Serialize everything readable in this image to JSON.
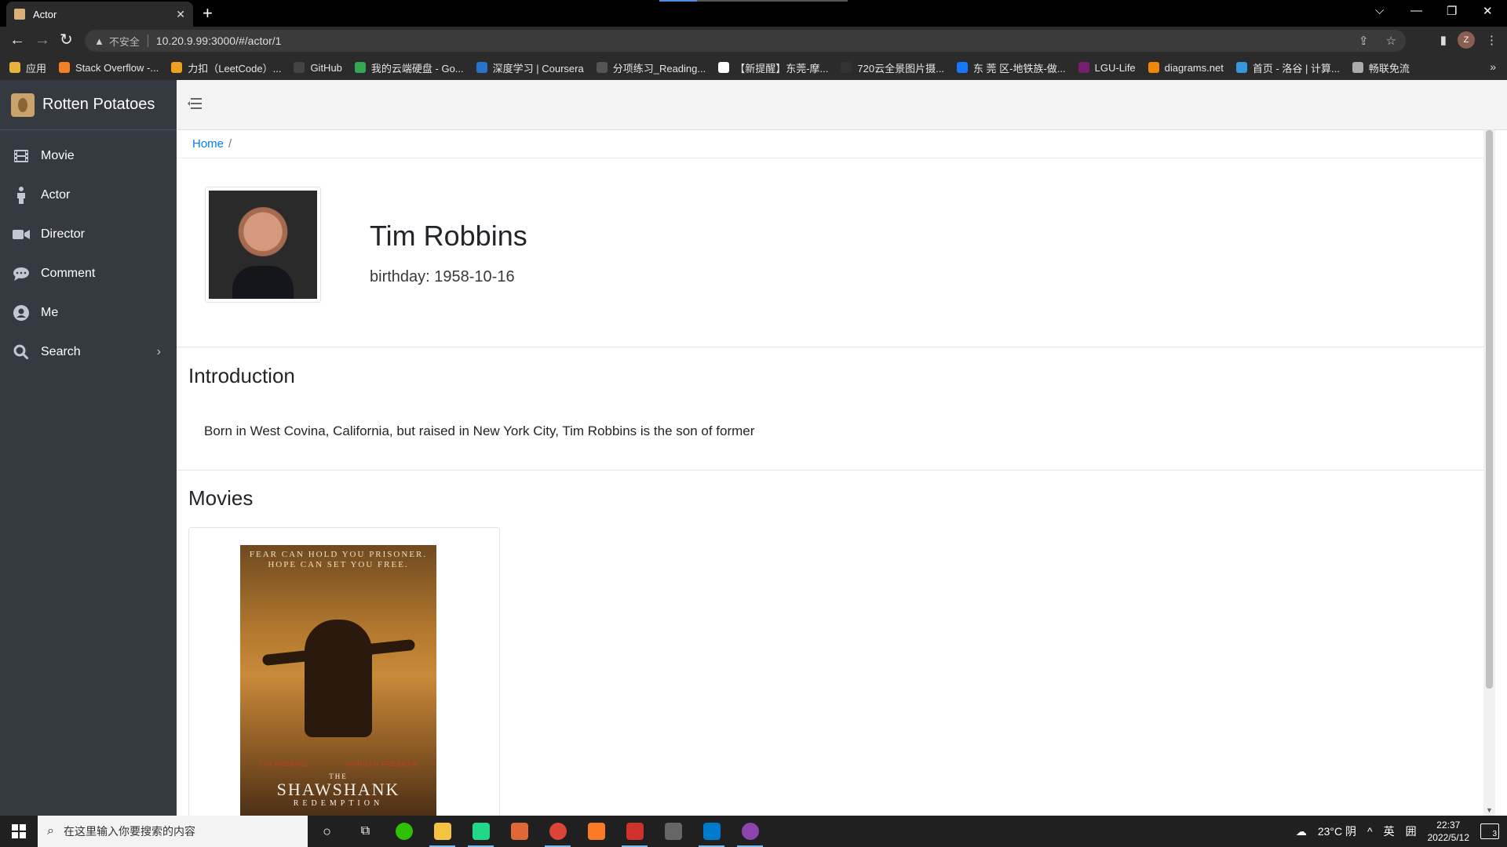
{
  "browser": {
    "tab_title": "Actor",
    "new_tab": "+",
    "address_insecure": "不安全",
    "address_url": "10.20.9.99:3000/#/actor/1",
    "profile_initial": "Z",
    "bookmarks": [
      {
        "label": "应用",
        "color": "#e8b33c"
      },
      {
        "label": "Stack Overflow -...",
        "color": "#f48024"
      },
      {
        "label": "力扣（LeetCode）...",
        "color": "#f0a020"
      },
      {
        "label": "GitHub",
        "color": "#444444"
      },
      {
        "label": "我的云端硬盘 - Go...",
        "color": "#34a853"
      },
      {
        "label": "深度学习 | Coursera",
        "color": "#2a73cc"
      },
      {
        "label": "分项练习_Reading...",
        "color": "#555555"
      },
      {
        "label": "【新提醒】东莞-摩...",
        "color": "#ffffff"
      },
      {
        "label": "720云全景图片摄...",
        "color": "#333333"
      },
      {
        "label": "东 莞 区-地铁族-做...",
        "color": "#1677ff"
      },
      {
        "label": "LGU-Life",
        "color": "#7a1e6e"
      },
      {
        "label": "diagrams.net",
        "color": "#f08705"
      },
      {
        "label": "首页 - 洛谷 | 计算...",
        "color": "#3498db"
      },
      {
        "label": "畅联免流",
        "color": "#aaaaaa"
      }
    ]
  },
  "app": {
    "brand": "Rotten Potatoes",
    "nav": [
      {
        "label": "Movie",
        "icon": "film-icon"
      },
      {
        "label": "Actor",
        "icon": "person-icon"
      },
      {
        "label": "Director",
        "icon": "video-camera-icon"
      },
      {
        "label": "Comment",
        "icon": "comment-icon"
      },
      {
        "label": "Me",
        "icon": "user-circle-icon"
      },
      {
        "label": "Search",
        "icon": "search-icon"
      }
    ],
    "breadcrumb": {
      "home": "Home",
      "separator": "/"
    }
  },
  "actor": {
    "name": "Tim Robbins",
    "birthday": "birthday: 1958-10-16",
    "intro_title": "Introduction",
    "intro_text": "Born in West Covina, California, but raised in New York City, Tim Robbins is the son of former",
    "movies_title": "Movies"
  },
  "poster": {
    "tagline1": "FEAR CAN HOLD YOU PRISONER.",
    "tagline2": "HOPE CAN SET YOU FREE.",
    "actor1": "TIM ROBBINS",
    "actor2": "MORGAN FREEMAN",
    "the": "THE",
    "title": "SHAWSHANK",
    "subtitle": "REDEMPTION"
  },
  "taskbar": {
    "search_placeholder": "在这里输入你要搜索的内容",
    "weather": "23°C 阴",
    "ime1": "英",
    "ime2": "囲",
    "time": "22:37",
    "date": "2022/5/12",
    "notifications": "3"
  },
  "colors": {
    "sidebar": "#343a40",
    "link": "#007bff",
    "topnav": "#f4f4f4"
  }
}
